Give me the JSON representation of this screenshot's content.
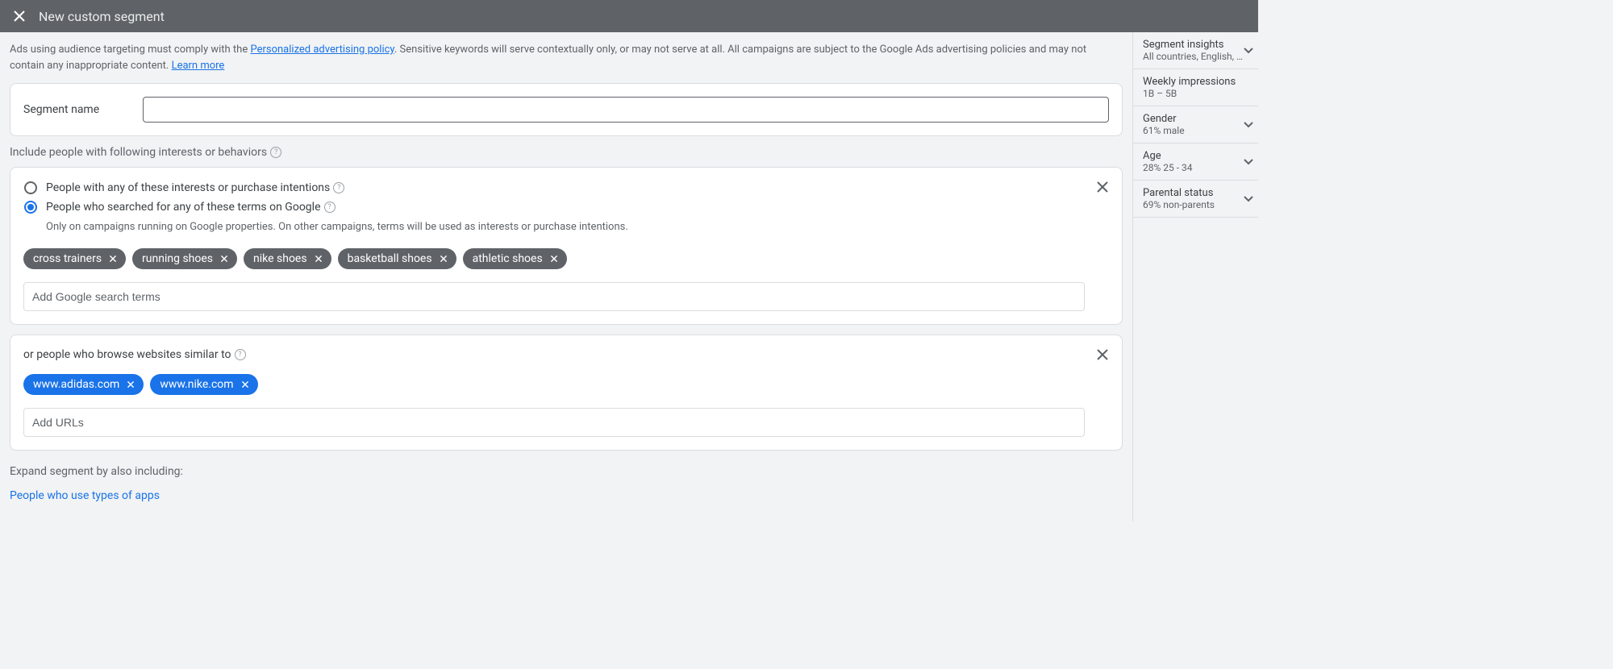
{
  "header": {
    "title": "New custom segment"
  },
  "policy": {
    "text_before_link1": "Ads using audience targeting must comply with the ",
    "link1": "Personalized advertising policy",
    "text_between": ". Sensitive keywords will serve contextually only, or may not serve at all. All campaigns are subject to the Google Ads advertising policies and may not contain any inappropriate content. ",
    "link2": "Learn more"
  },
  "segment_name": {
    "label": "Segment name",
    "value": ""
  },
  "include": {
    "section_label": "Include people with following interests or behaviors",
    "radio1_label": "People with any of these interests or purchase intentions",
    "radio2_label": "People who searched for any of these terms on Google",
    "radio2_sublabel": "Only on campaigns running on Google properties. On other campaigns, terms will be used as interests or purchase intentions.",
    "selected": "radio2",
    "chips": [
      "cross trainers",
      "running shoes",
      "nike shoes",
      "basketball shoes",
      "athletic shoes"
    ],
    "input_placeholder": "Add Google search terms"
  },
  "websites": {
    "label": "or people who browse websites similar to",
    "chips": [
      "www.adidas.com",
      "www.nike.com"
    ],
    "input_placeholder": "Add URLs"
  },
  "expand": {
    "label": "Expand segment by also including:",
    "link": "People who use types of apps"
  },
  "insights": {
    "sections": [
      {
        "title": "Segment insights",
        "sub": "All countries, English, All...",
        "expandable": true
      },
      {
        "title": "Weekly impressions",
        "sub": "1B – 5B",
        "expandable": false
      },
      {
        "title": "Gender",
        "sub": "61% male",
        "expandable": true
      },
      {
        "title": "Age",
        "sub": "28% 25 - 34",
        "expandable": true
      },
      {
        "title": "Parental status",
        "sub": "69% non-parents",
        "expandable": true
      }
    ]
  }
}
